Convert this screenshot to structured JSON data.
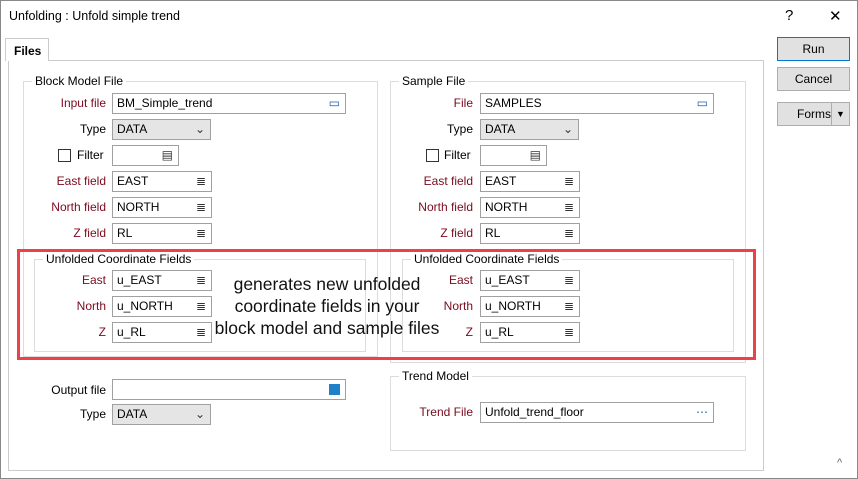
{
  "window": {
    "title": "Unfolding : Unfold simple trend",
    "help": "?",
    "close": "✕"
  },
  "tabs": [
    {
      "label": "Files"
    }
  ],
  "buttons": {
    "run": "Run",
    "cancel": "Cancel",
    "forms": "Forms"
  },
  "block_model": {
    "legend": "Block Model File",
    "input_file_label": "Input file",
    "input_file": "BM_Simple_trend",
    "type_label": "Type",
    "type": "DATA",
    "filter_label": "Filter",
    "filter": "",
    "east_label": "East field",
    "east": "EAST",
    "north_label": "North field",
    "north": "NORTH",
    "z_label": "Z field",
    "z": "RL",
    "unfolded": {
      "legend": "Unfolded Coordinate Fields",
      "east_label": "East",
      "east": "u_EAST",
      "north_label": "North",
      "north": "u_NORTH",
      "z_label": "Z",
      "z": "u_RL"
    }
  },
  "sample": {
    "legend": "Sample File",
    "file_label": "File",
    "file": "SAMPLES",
    "type_label": "Type",
    "type": "DATA",
    "filter_label": "Filter",
    "filter": "",
    "east_label": "East field",
    "east": "EAST",
    "north_label": "North field",
    "north": "NORTH",
    "z_label": "Z field",
    "z": "RL",
    "unfolded": {
      "legend": "Unfolded Coordinate Fields",
      "east_label": "East",
      "east": "u_EAST",
      "north_label": "North",
      "north": "u_NORTH",
      "z_label": "Z",
      "z": "u_RL"
    }
  },
  "output": {
    "file_label": "Output file",
    "file": "",
    "type_label": "Type",
    "type": "DATA"
  },
  "trend": {
    "legend": "Trend Model",
    "file_label": "Trend File",
    "file": "Unfold_trend_floor"
  },
  "annotation": {
    "lines": [
      "generates new unfolded",
      "coordinate fields in your",
      "block model and sample files"
    ]
  },
  "colors": {
    "required_label": "#7a0a1e",
    "highlight": "#ef4048",
    "default_button": "#0078d7"
  }
}
